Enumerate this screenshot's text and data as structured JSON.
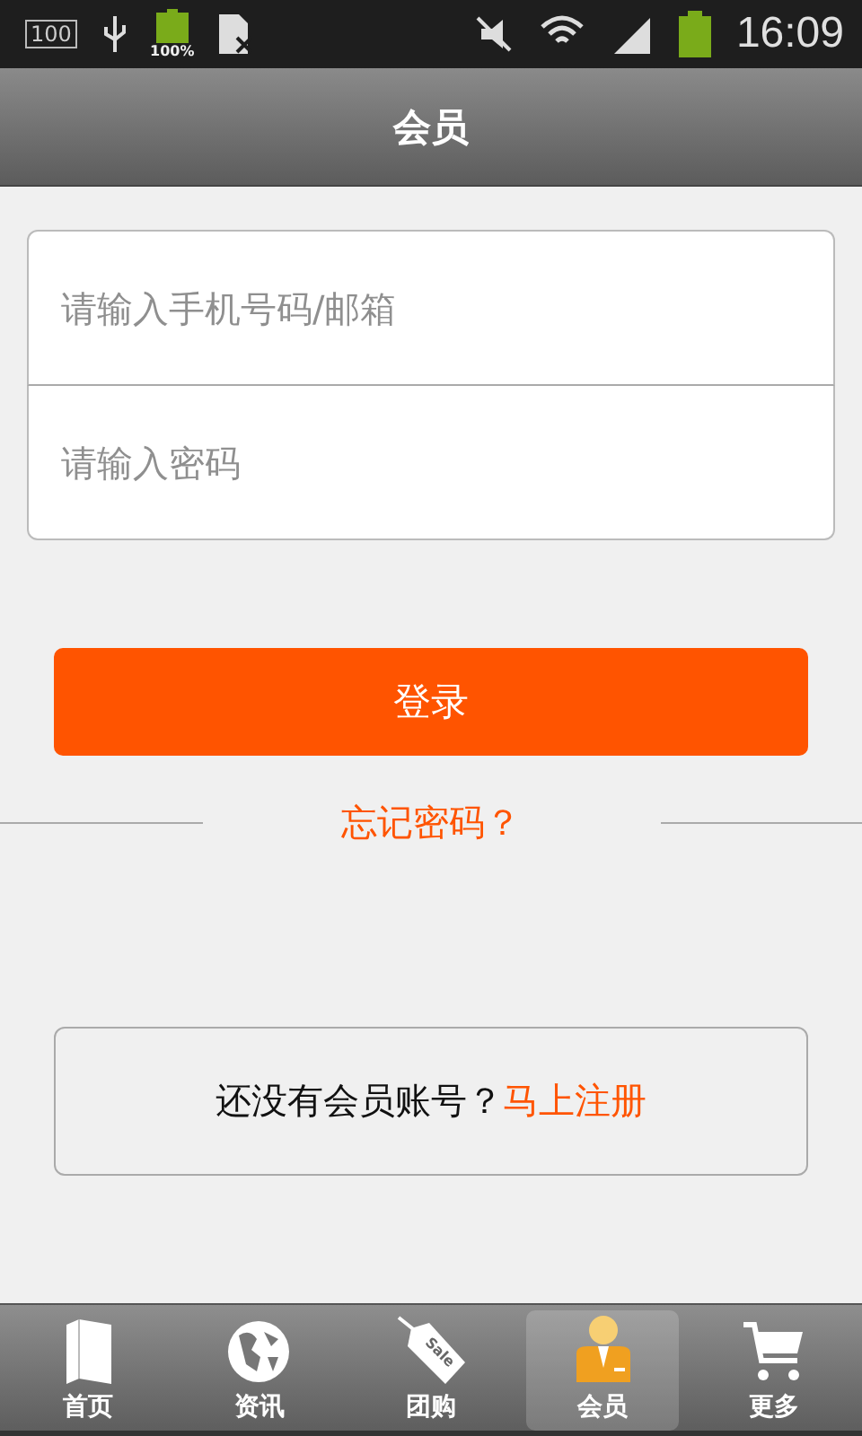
{
  "status_bar": {
    "storage": "100",
    "battery_small": "100%",
    "time": "16:09"
  },
  "header": {
    "title": "会员"
  },
  "login_form": {
    "account_placeholder": "请输入手机号码/邮箱",
    "password_placeholder": "请输入密码",
    "submit": "登录",
    "forgot": "忘记密码？"
  },
  "register": {
    "prompt": "还没有会员账号？",
    "link": "马上注册"
  },
  "tab_bar": [
    {
      "kind": "book",
      "label": "首页",
      "selected": false
    },
    {
      "kind": "globe",
      "label": "资讯",
      "selected": false
    },
    {
      "kind": "tag",
      "label": "团购",
      "selected": false,
      "icon_text": "Sale"
    },
    {
      "kind": "member",
      "label": "会员",
      "selected": true
    },
    {
      "kind": "cart",
      "label": "更多",
      "selected": false
    }
  ]
}
